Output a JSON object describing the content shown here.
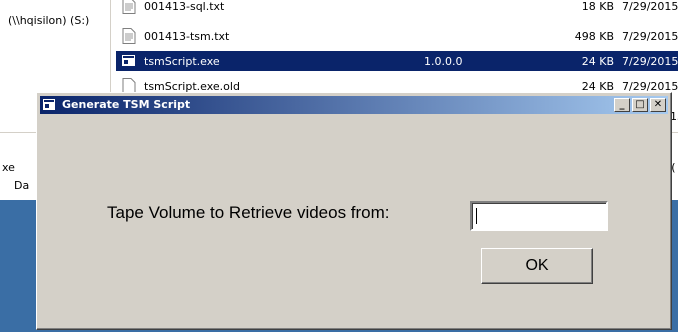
{
  "explorer": {
    "nav_item": "(\\\\hqisilon) (S:)",
    "files": [
      {
        "name": "001413-sql.txt",
        "version": "",
        "size": "18 KB",
        "date": "7/29/2015",
        "selected": false,
        "kind": "document"
      },
      {
        "name": "001413-tsm.txt",
        "version": "",
        "size": "498 KB",
        "date": "7/29/2015",
        "selected": false,
        "kind": "document"
      },
      {
        "name": "tsmScript.exe",
        "version": "1.0.0.0",
        "size": "24 KB",
        "date": "7/29/2015",
        "selected": true,
        "kind": "application"
      },
      {
        "name": "tsmScript.exe.old",
        "version": "",
        "size": "24 KB",
        "date": "7/29/2015",
        "selected": false,
        "kind": "document"
      }
    ],
    "details_fragment_1": "xe",
    "details_fragment_2": "Da",
    "right_fragment": "15",
    "right_fragment_2": "; ("
  },
  "dialog": {
    "title": "Generate TSM Script",
    "prompt": "Tape Volume to Retrieve videos from:",
    "input_value": "",
    "ok_label": "OK",
    "minimize_glyph": "_",
    "maximize_glyph": "□",
    "close_glyph": "✕"
  },
  "colors": {
    "selection": "#0a246a",
    "title_gradient_start": "#0a246a",
    "title_gradient_end": "#a6caf0",
    "dialog_face": "#d4d0c8",
    "desktop_blue": "#3a6ea5"
  },
  "icons": {
    "dialog_icon": "application-window-icon",
    "file_icon": "text-document-icon"
  }
}
